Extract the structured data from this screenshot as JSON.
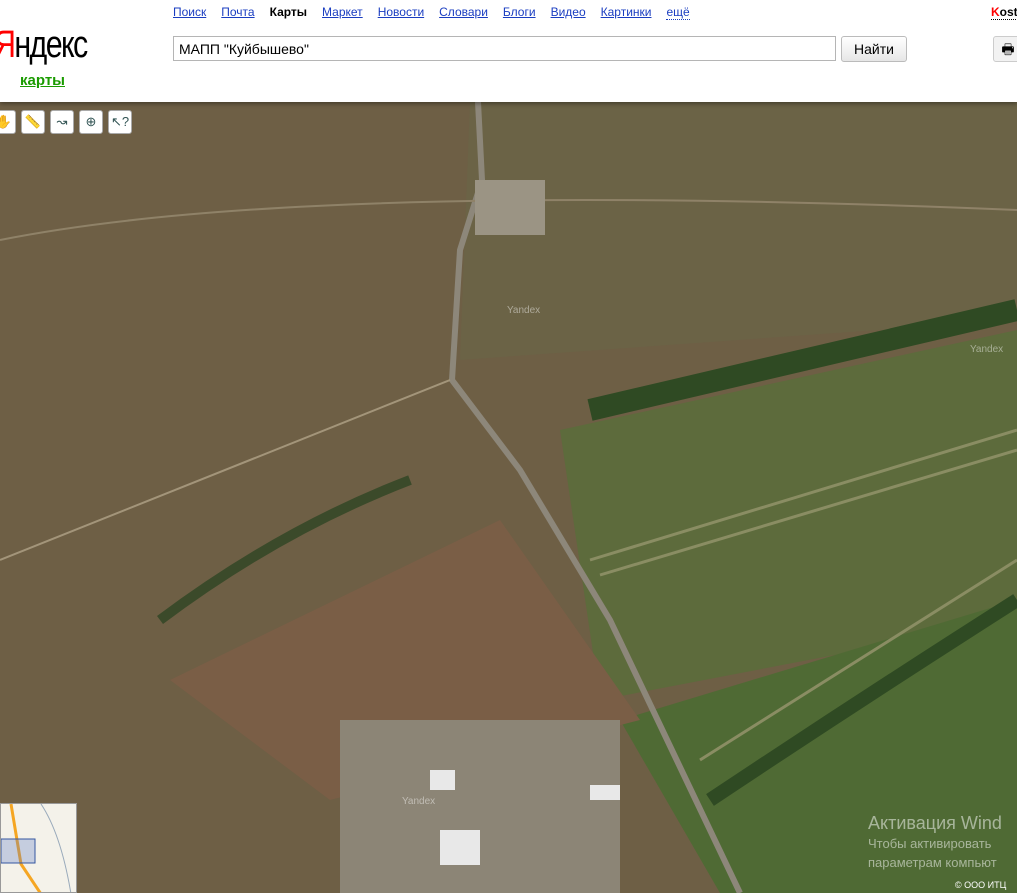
{
  "header": {
    "logo": "Яндекс",
    "logo_first": "Я",
    "logo_rest": "ндекс",
    "service": "карты",
    "nav": [
      "Поиск",
      "Почта",
      "Карты",
      "Маркет",
      "Новости",
      "Словари",
      "Блоги",
      "Видео",
      "Картинки",
      "ещё"
    ],
    "search_value": "МАПП \"Куйбышево\"",
    "search_button": "Найти",
    "user_first": "K",
    "user_rest": "ost"
  },
  "map": {
    "watermark": "Yandex",
    "toolbar": [
      "ruler-icon",
      "route-icon",
      "add-object-icon",
      "help-cursor-icon"
    ],
    "copyright": "© ООО ИТЦ"
  },
  "overlay": {
    "title": "Активация Wind",
    "line1": "Чтобы активировать",
    "line2": "параметрам компьют"
  }
}
